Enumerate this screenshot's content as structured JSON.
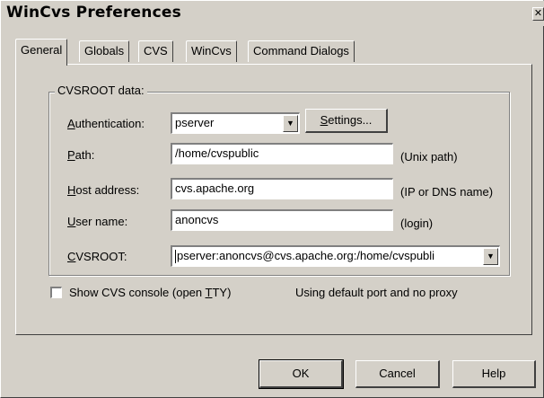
{
  "window": {
    "title": "WinCvs Preferences",
    "close_glyph": "✕"
  },
  "tabs": [
    {
      "label": "General",
      "active": true
    },
    {
      "label": "Globals",
      "active": false
    },
    {
      "label": "CVS",
      "active": false
    },
    {
      "label": "WinCvs",
      "active": false
    },
    {
      "label": "Command Dialogs",
      "active": false
    }
  ],
  "group": {
    "legend": "CVSROOT data:"
  },
  "authentication": {
    "label_mnemonic": "A",
    "label_rest": "uthentication:",
    "value": "pserver",
    "settings_mnemonic": "S",
    "settings_rest": "ettings..."
  },
  "path": {
    "label_mnemonic": "P",
    "label_rest": "ath:",
    "value": "/home/cvspublic",
    "hint": "(Unix path)"
  },
  "host": {
    "label_mnemonic": "H",
    "label_rest": "ost address:",
    "value": "cvs.apache.org",
    "hint": "(IP or DNS name)"
  },
  "user": {
    "label_mnemonic": "U",
    "label_rest": "ser name:",
    "value": "anoncvs",
    "hint": "(login)"
  },
  "cvsroot": {
    "label_mnemonic": "C",
    "label_rest": "VSROOT:",
    "value": "pserver:anoncvs@cvs.apache.org:/home/cvspubli"
  },
  "console": {
    "label_pre": "Show CVS console (open ",
    "label_mnemonic": "T",
    "label_post": "TY)",
    "checked": false
  },
  "proxy_status": "Using default port and no proxy",
  "buttons": {
    "ok": "OK",
    "cancel": "Cancel",
    "help": "Help"
  },
  "icons": {
    "dropdown": "▼"
  },
  "colors": {
    "face": "#d4d0c8",
    "highlight": "#ffffff",
    "shadow": "#808080",
    "dark_shadow": "#404040"
  }
}
